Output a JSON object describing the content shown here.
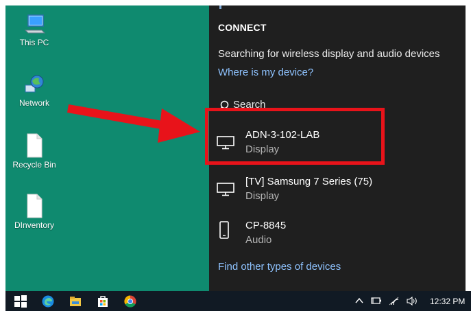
{
  "desktop": {
    "icons": [
      {
        "label": "This PC",
        "icon": "computer-icon"
      },
      {
        "label": "Network",
        "icon": "network-globe-icon"
      },
      {
        "label": "Recycle Bin",
        "icon": "document-icon"
      },
      {
        "label": "DInventory",
        "icon": "document-icon"
      }
    ],
    "background_color": "#0f8a6f"
  },
  "connect_panel": {
    "title": "CONNECT",
    "status": "Searching for wireless display and audio devices",
    "help_link": "Where is my device?",
    "search_label": "Search",
    "devices": [
      {
        "name": "ADN-3-102-LAB",
        "type": "Display",
        "icon": "monitor-icon"
      },
      {
        "name": "[TV] Samsung 7 Series (75)",
        "type": "Display",
        "icon": "monitor-icon"
      },
      {
        "name": "CP-8845",
        "type": "Audio",
        "icon": "phone-icon"
      }
    ],
    "footer_link": "Find other types of devices",
    "background_color": "#1f1f1f",
    "link_color": "#8fc3ff"
  },
  "annotation": {
    "highlight_color": "#e8131a",
    "highlighted_device": "ADN-3-102-LAB"
  },
  "taskbar": {
    "apps": [
      "windows-start-icon",
      "edge-icon",
      "file-explorer-icon",
      "store-icon",
      "chrome-icon"
    ],
    "tray": [
      "chevron-up-icon",
      "battery-icon",
      "wifi-icon",
      "volume-icon"
    ],
    "time": "12:32 PM"
  }
}
